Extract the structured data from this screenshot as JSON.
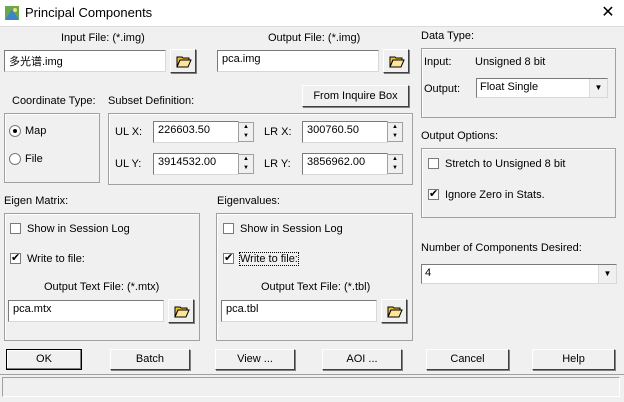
{
  "window": {
    "title": "Principal Components",
    "close_glyph": "✕"
  },
  "input_file": {
    "label": "Input File: (*.img)",
    "value": "多光谱.img"
  },
  "output_file": {
    "label": "Output File: (*.img)",
    "value": "pca.img"
  },
  "data_type": {
    "label": "Data Type:",
    "input_label": "Input:",
    "input_value": "Unsigned 8 bit",
    "output_label": "Output:",
    "output_value": "Float Single"
  },
  "coordinate_type": {
    "label": "Coordinate Type:",
    "options": [
      "Map",
      "File"
    ],
    "selected": "Map"
  },
  "subset": {
    "label": "Subset Definition:",
    "from_inquire_label": "From Inquire Box",
    "ulx_label": "UL X:",
    "ulx": "226603.50",
    "uly_label": "UL Y:",
    "uly": "3914532.00",
    "lrx_label": "LR X:",
    "lrx": "300760.50",
    "lry_label": "LR Y:",
    "lry": "3856962.00"
  },
  "output_options": {
    "label": "Output Options:",
    "stretch_label": "Stretch to Unsigned 8 bit",
    "stretch_checked": false,
    "ignore_zero_label": "Ignore Zero in Stats.",
    "ignore_zero_checked": true
  },
  "eigen_matrix": {
    "label": "Eigen Matrix:",
    "show_log_label": "Show in Session Log",
    "show_log_checked": false,
    "write_file_label": "Write to file:",
    "write_file_checked": true,
    "output_label": "Output Text File: (*.mtx)",
    "output_value": "pca.mtx"
  },
  "eigenvalues": {
    "label": "Eigenvalues:",
    "show_log_label": "Show in Session Log",
    "show_log_checked": false,
    "write_file_label": "Write to file:",
    "write_file_checked": true,
    "output_label": "Output Text File: (*.tbl)",
    "output_value": "pca.tbl"
  },
  "components": {
    "label": "Number of Components Desired:",
    "value": "4"
  },
  "buttons": {
    "ok": "OK",
    "batch": "Batch",
    "view": "View ...",
    "aoi": "AOI ...",
    "cancel": "Cancel",
    "help": "Help"
  },
  "icons": [
    "app-icon",
    "close-icon",
    "folder-open-icon",
    "dropdown-arrow-icon",
    "spin-up-icon",
    "spin-down-icon"
  ]
}
